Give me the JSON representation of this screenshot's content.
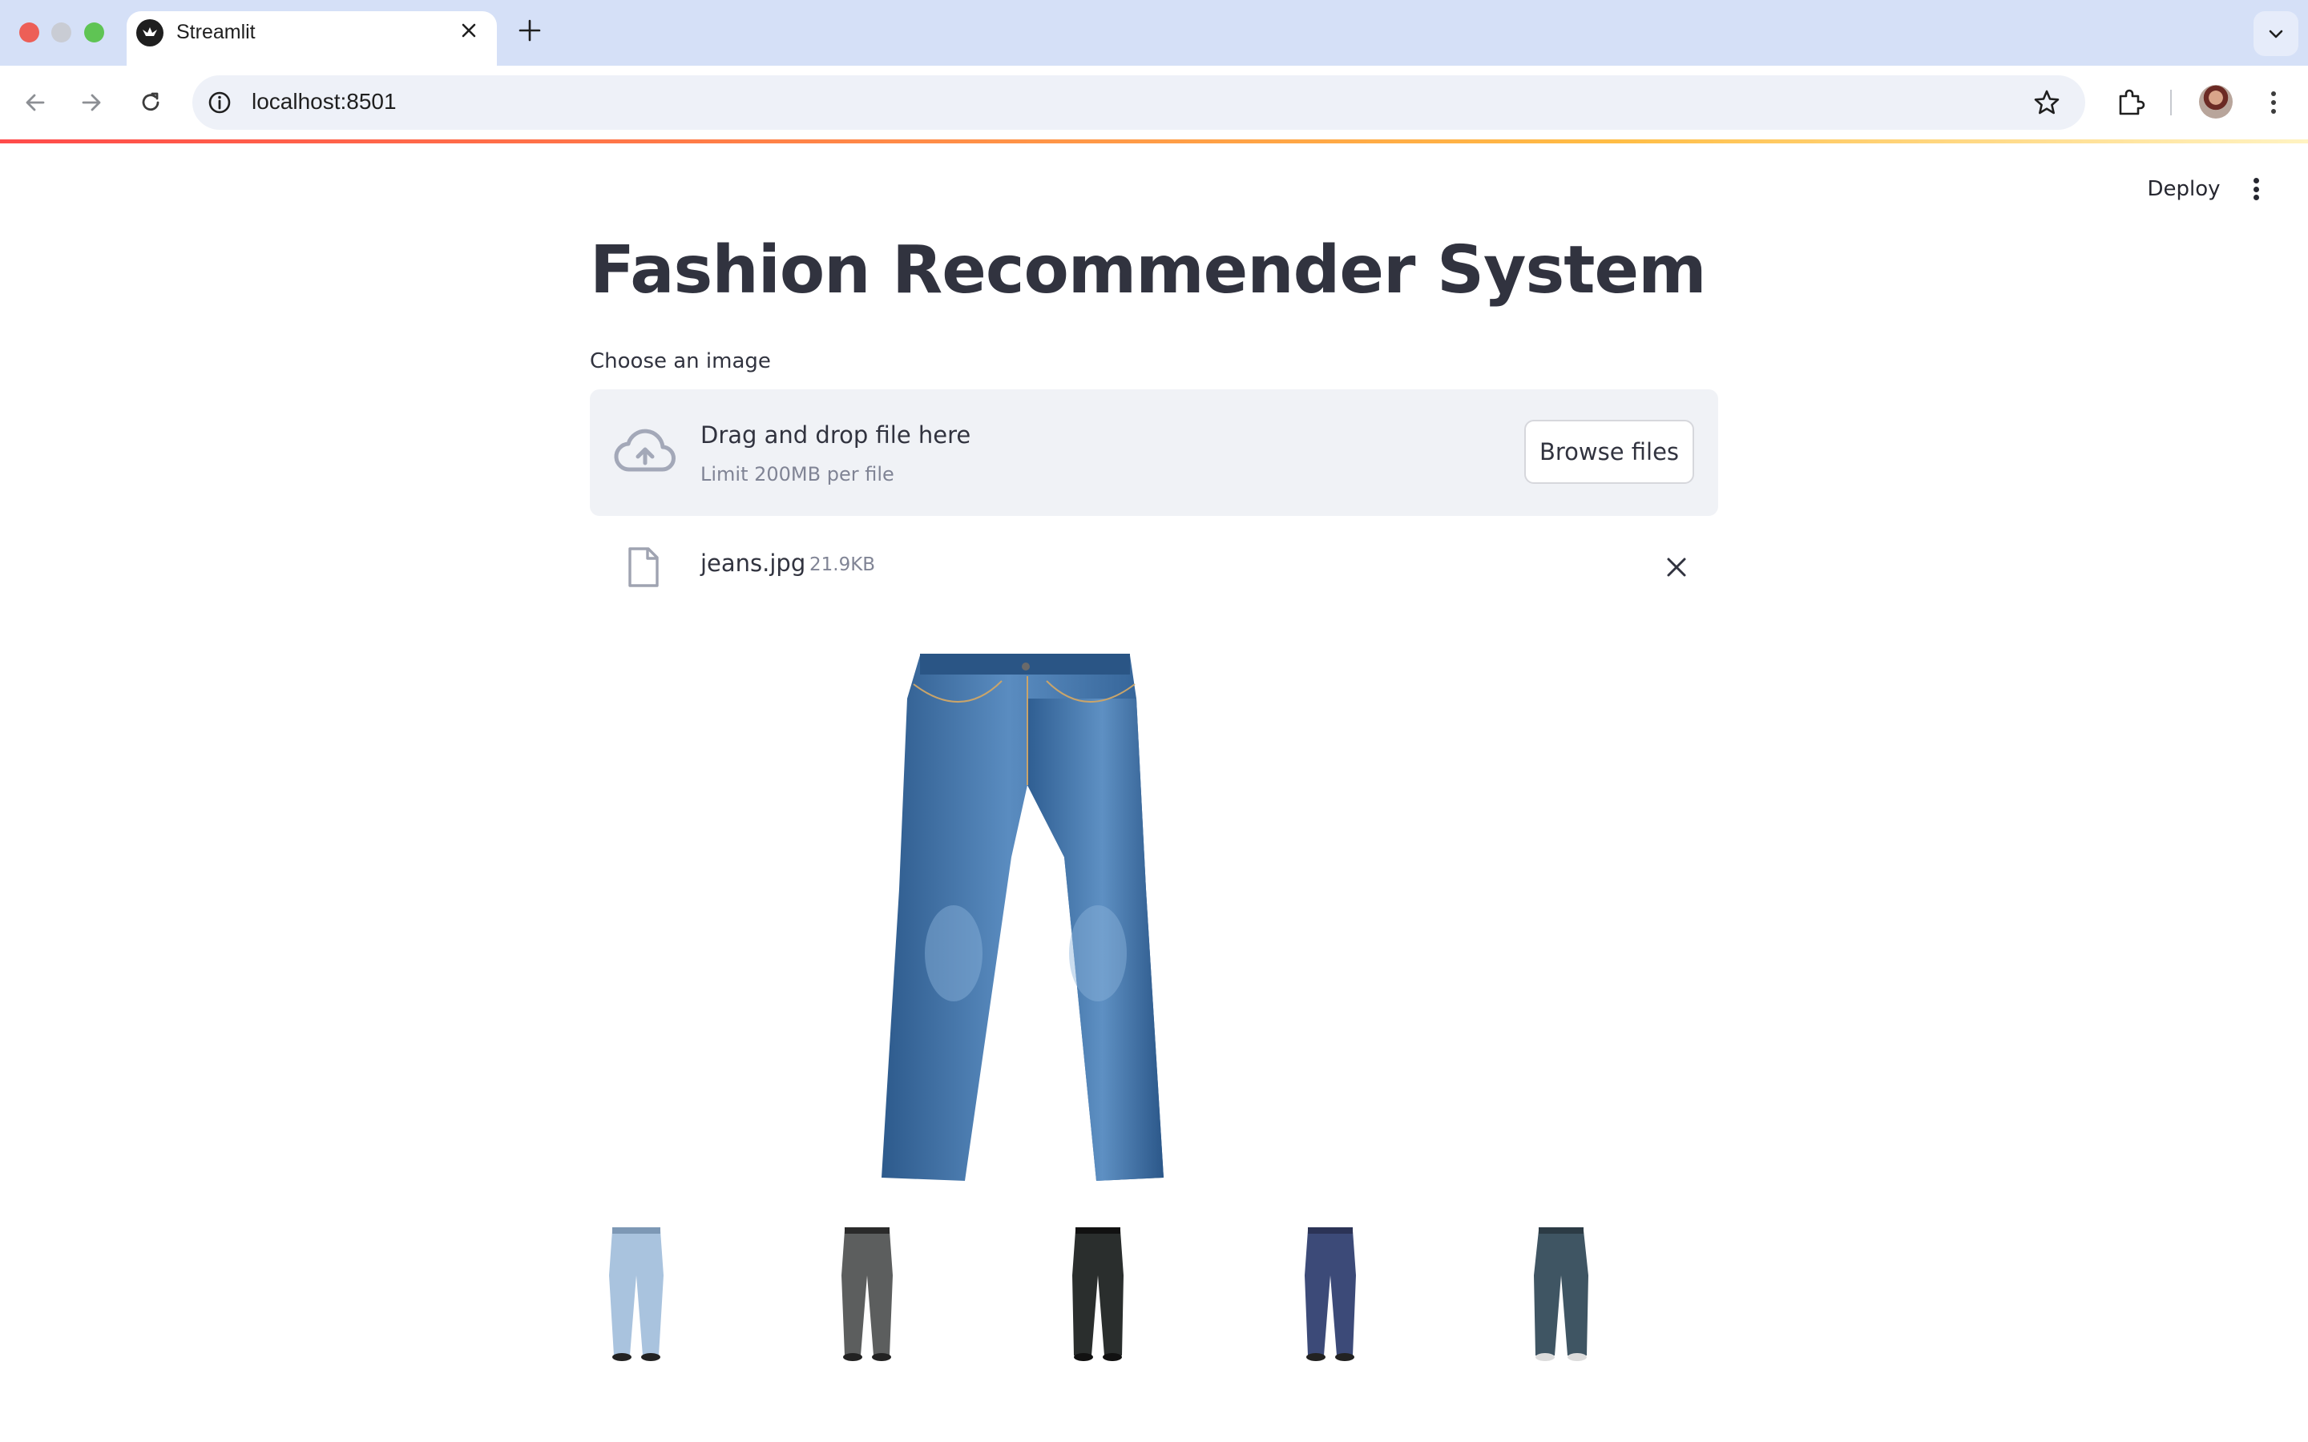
{
  "browser": {
    "tab_title": "Streamlit",
    "url": "localhost:8501"
  },
  "app": {
    "deploy_label": "Deploy",
    "title": "Fashion Recommender System",
    "uploader": {
      "label": "Choose an image",
      "drop_text": "Drag and drop file here",
      "limit_text": "Limit 200MB per file",
      "browse_label": "Browse files"
    },
    "uploaded_file": {
      "name": "jeans.jpg",
      "size": "21.9KB"
    },
    "query_image": "jeans-image",
    "recommendations": [
      {
        "icon": "light-wash-jeans-image",
        "color": "#a9c3de"
      },
      {
        "icon": "grey-trousers-image",
        "color": "#5c5e5e"
      },
      {
        "icon": "black-trousers-image",
        "color": "#2a2e2d"
      },
      {
        "icon": "navy-trousers-image",
        "color": "#3c4a78"
      },
      {
        "icon": "dark-wash-jeans-image",
        "color": "#3f5563"
      }
    ]
  },
  "colors": {
    "accent_gradient_start": "#ff4b4b",
    "accent_gradient_end": "#ffbd45",
    "text": "#31333f",
    "muted": "#808495",
    "denim": "#3f6e9f"
  }
}
